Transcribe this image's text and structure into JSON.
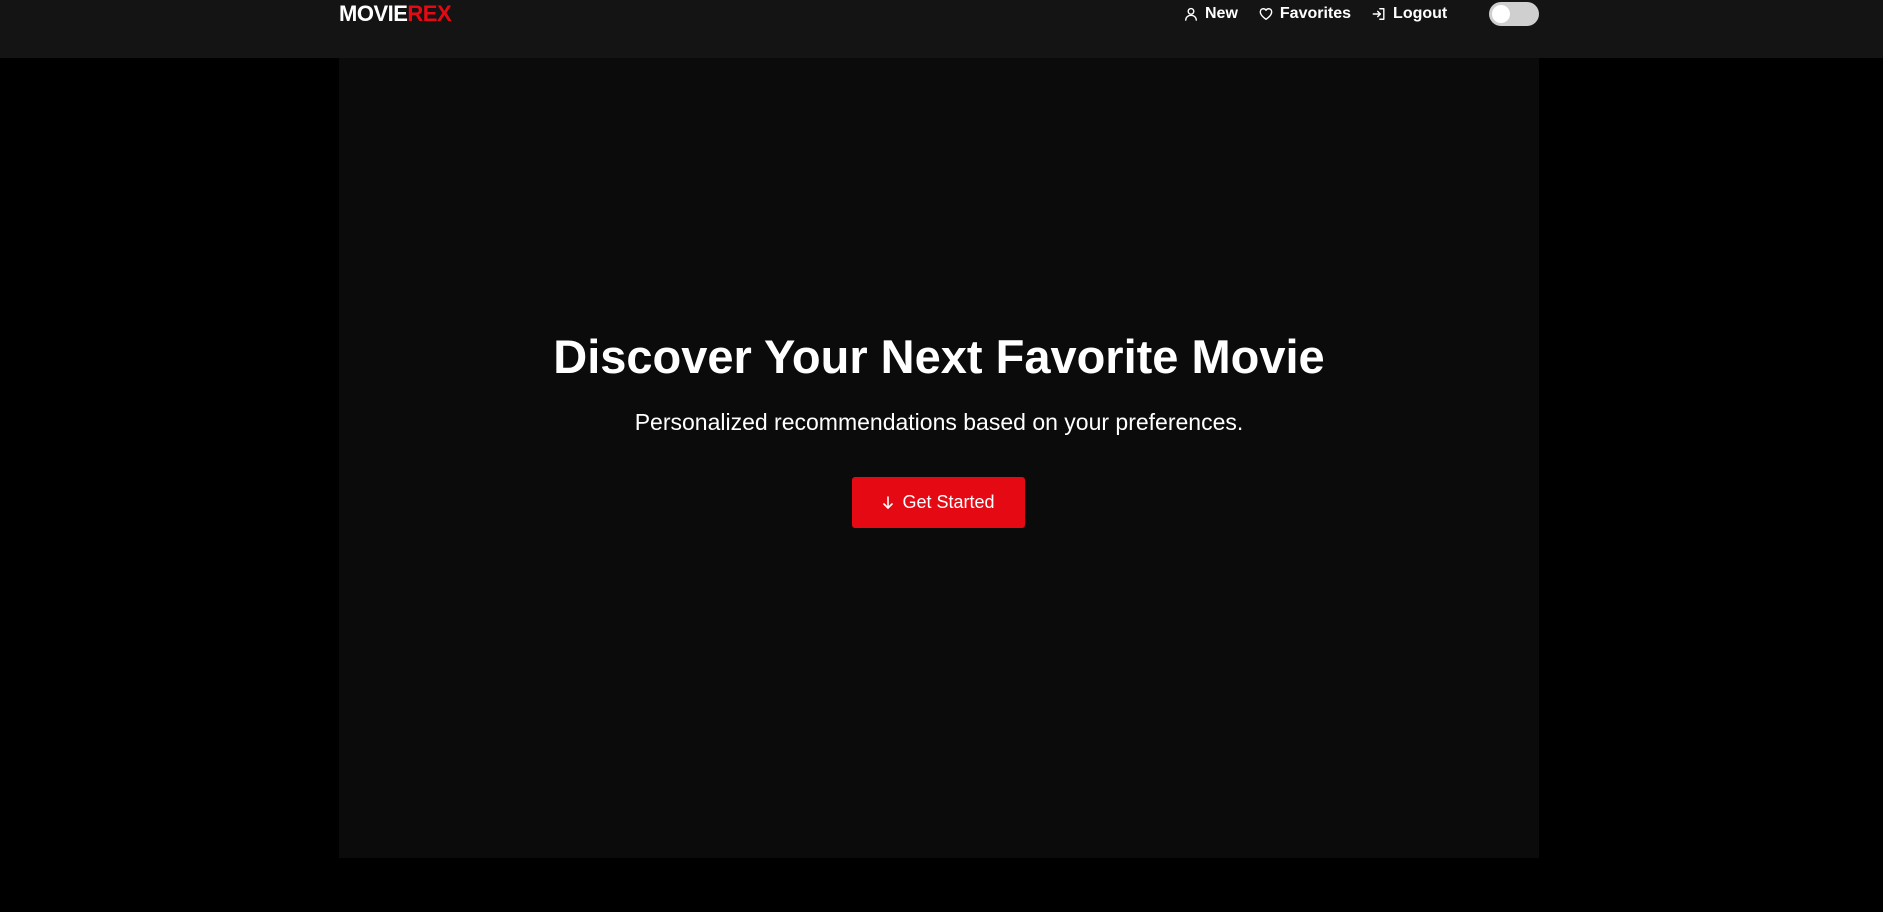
{
  "brand": {
    "logo_part1": "MOVIE",
    "logo_part2": "REX",
    "accent_color": "#e50914"
  },
  "nav": {
    "items": [
      {
        "label": "New",
        "icon": "user-icon"
      },
      {
        "label": "Favorites",
        "icon": "heart-icon"
      },
      {
        "label": "Logout",
        "icon": "logout-icon"
      }
    ],
    "theme_toggle": {
      "state": "off"
    }
  },
  "hero": {
    "title": "Discover Your Next Favorite Movie",
    "subtitle": "Personalized recommendations based on your preferences.",
    "cta_label": "Get Started",
    "cta_icon": "arrow-down-icon"
  }
}
